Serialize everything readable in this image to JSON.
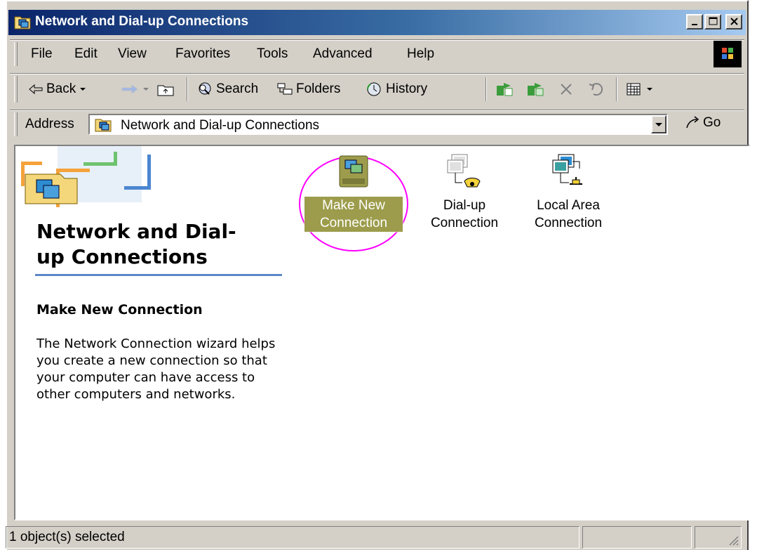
{
  "window": {
    "title": "Network and Dial-up Connections",
    "buttons": [
      "minimize",
      "maximize",
      "close"
    ]
  },
  "menu": {
    "items": [
      "File",
      "Edit",
      "View",
      "Favorites",
      "Tools",
      "Advanced",
      "Help"
    ]
  },
  "toolbar": {
    "back_label": "Back",
    "search_label": "Search",
    "folders_label": "Folders",
    "history_label": "History"
  },
  "address": {
    "label": "Address",
    "value": "Network and Dial-up Connections",
    "go_label": "Go"
  },
  "left_panel": {
    "title_line1": "Network and Dial-",
    "title_line2": "up Connections",
    "selected_heading": "Make New Connection",
    "description": "The Network Connection wizard helps you create a new connection so that your computer can have access to other computers and networks."
  },
  "icons": [
    {
      "line1": "Make New",
      "line2": "Connection",
      "selected": true,
      "icon": "make-new-connection-icon"
    },
    {
      "line1": "Dial-up",
      "line2": "Connection",
      "selected": false,
      "icon": "dialup-connection-icon"
    },
    {
      "line1": "Local Area",
      "line2": "Connection",
      "selected": false,
      "icon": "local-area-connection-icon"
    }
  ],
  "status": {
    "text": "1 object(s) selected"
  },
  "colors": {
    "titlebar_start": "#0a246a",
    "titlebar_end": "#a6caf0",
    "highlight_ring": "#ff00ff",
    "selection_bg": "#9c9c4c",
    "rule": "#5b88c7"
  }
}
